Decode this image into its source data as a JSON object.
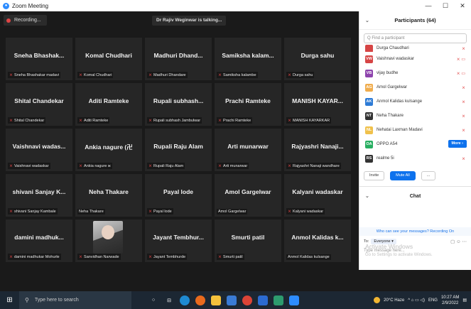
{
  "window": {
    "title": "Zoom Meeting",
    "controls": [
      "—",
      "☐",
      "✕"
    ]
  },
  "meeting": {
    "recording_label": "Recording...",
    "talking_label": "Dr Rajiv Weginwar is talking..."
  },
  "tiles": [
    {
      "big": "Sneha  Bhashak...",
      "small": "Sneha Bhashakar madavi",
      "muted": true
    },
    {
      "big": "Komal Chudhari",
      "small": "Komal Chudhari",
      "muted": true
    },
    {
      "big": "Madhuri  Dhand...",
      "small": "Madhuri Dhandare",
      "muted": true
    },
    {
      "big": "Samiksha  kalam...",
      "small": "Samiksha kalambe",
      "muted": true
    },
    {
      "big": "Durga sahu",
      "small": "Durga sahu",
      "muted": true
    },
    {
      "big": "Shital Chandekar",
      "small": "Shital Chandekar",
      "muted": true
    },
    {
      "big": "Aditi Ramteke",
      "small": "Aditi Ramteke",
      "muted": true
    },
    {
      "big": "Rupali  subhash...",
      "small": "Rupali subhash Jambulwar",
      "muted": true
    },
    {
      "big": "Prachi Ramteke",
      "small": "Prachi Ramteke",
      "muted": true
    },
    {
      "big": "MANISH  KAYAR...",
      "small": "MANISH KAYARKAR",
      "muted": true
    },
    {
      "big": "Vaishnavi  wadas...",
      "small": "Vaishnavi wadaskar",
      "muted": true
    },
    {
      "big": "Ankia  nagure (卍",
      "small": "Ankia nagure ж",
      "muted": true
    },
    {
      "big": "Rupali Raju Alam",
      "small": "Rupali Raju Alam",
      "muted": true
    },
    {
      "big": "Arti munarwar",
      "small": "Arti munarwar",
      "muted": true
    },
    {
      "big": "Rajyashri  Nanaji...",
      "small": "Rajyashri Nanaji wandhare",
      "muted": true
    },
    {
      "big": "shivani  Sanjay  K...",
      "small": "shivani Sanjay Kambale",
      "muted": true
    },
    {
      "big": "Neha Thakare",
      "small": "Neha Thakare",
      "muted": false
    },
    {
      "big": "Payal lode",
      "small": "Payal lode",
      "muted": true
    },
    {
      "big": "Amol Gargelwar",
      "small": "Amol Gargelwar",
      "muted": false
    },
    {
      "big": "Kalyani wadaskar",
      "small": "Kalyani wadaskar",
      "muted": true
    },
    {
      "big": "damini  madhuk...",
      "small": "damini madhukar Mohurle",
      "muted": true
    },
    {
      "big": "",
      "small": "Sanvidhan Narwade",
      "muted": true,
      "photo": true
    },
    {
      "big": "Jayant  Tembhur...",
      "small": "Jayant Tembhurde",
      "muted": true
    },
    {
      "big": "Smurti patil",
      "small": "Smurti patil",
      "muted": true
    },
    {
      "big": "Anmol  Kalidas  k...",
      "small": "Anmol Kalidas kulsange",
      "muted": false
    }
  ],
  "participants_panel": {
    "title": "Participants (64)",
    "search_placeholder": "Q Find a participant",
    "items": [
      {
        "initials": "",
        "name": "Durga Chaudhari",
        "color": "#d64545"
      },
      {
        "initials": "VW",
        "name": "Vaishnavi wadaskar",
        "color": "#d64545"
      },
      {
        "initials": "VB",
        "name": "vijay budhe",
        "color": "#8e44ad"
      },
      {
        "initials": "AG",
        "name": "Amol Gargelwar",
        "color": "#f0ad4e"
      },
      {
        "initials": "AK",
        "name": "Anmol Kalidas kulsange",
        "color": "#2d7bd6"
      },
      {
        "initials": "NT",
        "name": "Neha Thakare",
        "color": "#333333"
      },
      {
        "initials": "NL",
        "name": "Nehatai Laxman Madavi",
        "color": "#f0c14b"
      },
      {
        "initials": "OA",
        "name": "OPPO A54",
        "color": "#27ae60"
      },
      {
        "initials": "RS",
        "name": "realme 5i",
        "color": "#333333"
      }
    ],
    "more_label": "More ›",
    "invite_label": "Invite",
    "mute_all_label": "Mute All",
    "ellipsis_label": "..."
  },
  "chat": {
    "title": "Chat",
    "who_see": "Who can see your messages? Recording On",
    "to_label": "To:",
    "recipient": "Everyone ▾",
    "message_placeholder": "Type message here..."
  },
  "watermark": {
    "line1": "Activate Windows",
    "line2": "Go to Settings to activate Windows."
  },
  "taskbar": {
    "search_placeholder": "Type here to search",
    "weather": "20°C  Haze",
    "lang": "ENG",
    "time": "10:27 AM",
    "date": "2/9/2022"
  }
}
